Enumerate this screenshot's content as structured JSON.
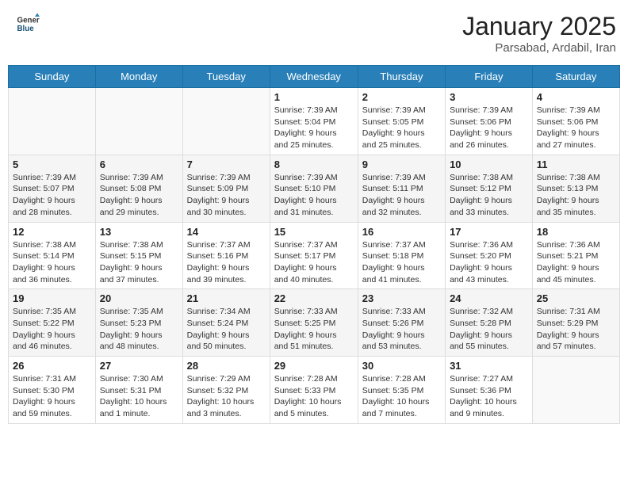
{
  "header": {
    "logo_general": "General",
    "logo_blue": "Blue",
    "month_title": "January 2025",
    "location": "Parsabad, Ardabil, Iran"
  },
  "weekdays": [
    "Sunday",
    "Monday",
    "Tuesday",
    "Wednesday",
    "Thursday",
    "Friday",
    "Saturday"
  ],
  "weeks": [
    [
      {
        "day": "",
        "info": ""
      },
      {
        "day": "",
        "info": ""
      },
      {
        "day": "",
        "info": ""
      },
      {
        "day": "1",
        "info": "Sunrise: 7:39 AM\nSunset: 5:04 PM\nDaylight: 9 hours\nand 25 minutes."
      },
      {
        "day": "2",
        "info": "Sunrise: 7:39 AM\nSunset: 5:05 PM\nDaylight: 9 hours\nand 25 minutes."
      },
      {
        "day": "3",
        "info": "Sunrise: 7:39 AM\nSunset: 5:06 PM\nDaylight: 9 hours\nand 26 minutes."
      },
      {
        "day": "4",
        "info": "Sunrise: 7:39 AM\nSunset: 5:06 PM\nDaylight: 9 hours\nand 27 minutes."
      }
    ],
    [
      {
        "day": "5",
        "info": "Sunrise: 7:39 AM\nSunset: 5:07 PM\nDaylight: 9 hours\nand 28 minutes."
      },
      {
        "day": "6",
        "info": "Sunrise: 7:39 AM\nSunset: 5:08 PM\nDaylight: 9 hours\nand 29 minutes."
      },
      {
        "day": "7",
        "info": "Sunrise: 7:39 AM\nSunset: 5:09 PM\nDaylight: 9 hours\nand 30 minutes."
      },
      {
        "day": "8",
        "info": "Sunrise: 7:39 AM\nSunset: 5:10 PM\nDaylight: 9 hours\nand 31 minutes."
      },
      {
        "day": "9",
        "info": "Sunrise: 7:39 AM\nSunset: 5:11 PM\nDaylight: 9 hours\nand 32 minutes."
      },
      {
        "day": "10",
        "info": "Sunrise: 7:38 AM\nSunset: 5:12 PM\nDaylight: 9 hours\nand 33 minutes."
      },
      {
        "day": "11",
        "info": "Sunrise: 7:38 AM\nSunset: 5:13 PM\nDaylight: 9 hours\nand 35 minutes."
      }
    ],
    [
      {
        "day": "12",
        "info": "Sunrise: 7:38 AM\nSunset: 5:14 PM\nDaylight: 9 hours\nand 36 minutes."
      },
      {
        "day": "13",
        "info": "Sunrise: 7:38 AM\nSunset: 5:15 PM\nDaylight: 9 hours\nand 37 minutes."
      },
      {
        "day": "14",
        "info": "Sunrise: 7:37 AM\nSunset: 5:16 PM\nDaylight: 9 hours\nand 39 minutes."
      },
      {
        "day": "15",
        "info": "Sunrise: 7:37 AM\nSunset: 5:17 PM\nDaylight: 9 hours\nand 40 minutes."
      },
      {
        "day": "16",
        "info": "Sunrise: 7:37 AM\nSunset: 5:18 PM\nDaylight: 9 hours\nand 41 minutes."
      },
      {
        "day": "17",
        "info": "Sunrise: 7:36 AM\nSunset: 5:20 PM\nDaylight: 9 hours\nand 43 minutes."
      },
      {
        "day": "18",
        "info": "Sunrise: 7:36 AM\nSunset: 5:21 PM\nDaylight: 9 hours\nand 45 minutes."
      }
    ],
    [
      {
        "day": "19",
        "info": "Sunrise: 7:35 AM\nSunset: 5:22 PM\nDaylight: 9 hours\nand 46 minutes."
      },
      {
        "day": "20",
        "info": "Sunrise: 7:35 AM\nSunset: 5:23 PM\nDaylight: 9 hours\nand 48 minutes."
      },
      {
        "day": "21",
        "info": "Sunrise: 7:34 AM\nSunset: 5:24 PM\nDaylight: 9 hours\nand 50 minutes."
      },
      {
        "day": "22",
        "info": "Sunrise: 7:33 AM\nSunset: 5:25 PM\nDaylight: 9 hours\nand 51 minutes."
      },
      {
        "day": "23",
        "info": "Sunrise: 7:33 AM\nSunset: 5:26 PM\nDaylight: 9 hours\nand 53 minutes."
      },
      {
        "day": "24",
        "info": "Sunrise: 7:32 AM\nSunset: 5:28 PM\nDaylight: 9 hours\nand 55 minutes."
      },
      {
        "day": "25",
        "info": "Sunrise: 7:31 AM\nSunset: 5:29 PM\nDaylight: 9 hours\nand 57 minutes."
      }
    ],
    [
      {
        "day": "26",
        "info": "Sunrise: 7:31 AM\nSunset: 5:30 PM\nDaylight: 9 hours\nand 59 minutes."
      },
      {
        "day": "27",
        "info": "Sunrise: 7:30 AM\nSunset: 5:31 PM\nDaylight: 10 hours\nand 1 minute."
      },
      {
        "day": "28",
        "info": "Sunrise: 7:29 AM\nSunset: 5:32 PM\nDaylight: 10 hours\nand 3 minutes."
      },
      {
        "day": "29",
        "info": "Sunrise: 7:28 AM\nSunset: 5:33 PM\nDaylight: 10 hours\nand 5 minutes."
      },
      {
        "day": "30",
        "info": "Sunrise: 7:28 AM\nSunset: 5:35 PM\nDaylight: 10 hours\nand 7 minutes."
      },
      {
        "day": "31",
        "info": "Sunrise: 7:27 AM\nSunset: 5:36 PM\nDaylight: 10 hours\nand 9 minutes."
      },
      {
        "day": "",
        "info": ""
      }
    ]
  ]
}
